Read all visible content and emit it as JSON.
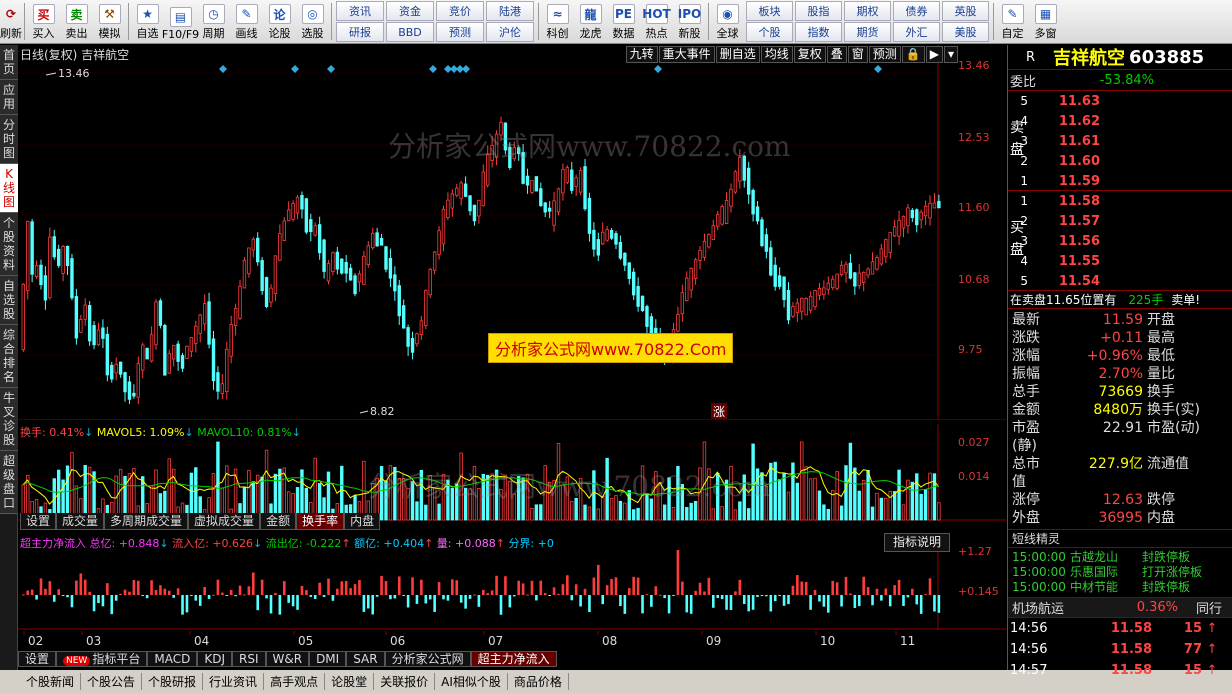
{
  "toolbar": {
    "group1": [
      {
        "label": "买入",
        "glyph": "买",
        "color": "#c00"
      },
      {
        "label": "卖出",
        "glyph": "卖",
        "color": "#080"
      },
      {
        "label": "模拟",
        "glyph": "⚒",
        "color": "#840"
      }
    ],
    "group2": [
      {
        "label": "自选",
        "glyph": "★"
      },
      {
        "label": "F10/F9",
        "glyph": "▤"
      },
      {
        "label": "周期",
        "glyph": "◷"
      },
      {
        "label": "画线",
        "glyph": "✎"
      },
      {
        "label": "论股",
        "glyph": "论"
      },
      {
        "label": "选股",
        "glyph": "◎"
      }
    ],
    "grid1": [
      "资讯",
      "资金",
      "竞价",
      "陆港",
      "研报",
      "BBD",
      "预测",
      "沪伦"
    ],
    "group3": [
      {
        "label": "科创",
        "glyph": "≈"
      },
      {
        "label": "龙虎",
        "glyph": "龍"
      },
      {
        "label": "数据",
        "glyph": "PE"
      },
      {
        "label": "热点",
        "glyph": "HOT"
      },
      {
        "label": "新股",
        "glyph": "IPO"
      }
    ],
    "group4": [
      {
        "label": "全球",
        "glyph": "◉"
      }
    ],
    "grid2": [
      "板块",
      "股指",
      "期权",
      "债券",
      "英股",
      "个股",
      "指数",
      "期货",
      "外汇",
      "美股"
    ],
    "group5": [
      {
        "label": "自定",
        "glyph": "✎"
      },
      {
        "label": "多窗",
        "glyph": "▦"
      }
    ],
    "left_label": "刷新"
  },
  "left_tabs": [
    "首页",
    "应用",
    "分时图",
    "K线图",
    "个股资料",
    "自选股",
    "综合排名",
    "牛叉诊股",
    "超级盘口"
  ],
  "chart": {
    "title": "日线(复权) 吉祥航空",
    "top_buttons": [
      "九转",
      "重大事件",
      "删自选",
      "均线",
      "复权",
      "叠",
      "窗",
      "预测"
    ],
    "price_labels": [
      "13.46",
      "12.53",
      "11.60",
      "10.68",
      "9.75"
    ],
    "high_label": "13.46",
    "low_label": "8.82",
    "zhang_label": "涨",
    "watermark": "分析家公式网www.70822.com",
    "watermark_center": "分析家公式网www.70822.Com",
    "watermark_2": "分析家公式网www.70822.com"
  },
  "volume": {
    "title_name": "换手:",
    "title_value": "0.41%",
    "ma5_name": "MAVOL5:",
    "ma5_value": "1.09%",
    "ma10_name": "MAVOL10:",
    "ma10_value": "0.81%",
    "y_labels": [
      "0.027",
      "0.014"
    ],
    "tabs": [
      "设置",
      "成交量",
      "多周期成交量",
      "虚拟成交量",
      "金额",
      "换手率",
      "内盘"
    ],
    "active_tab": "换手率"
  },
  "flow": {
    "title": "超主力净流入 总亿: +0.848",
    "in": "流入亿: +0.626",
    "out": "流出亿: -0.222",
    "amt": "额亿: +0.404",
    "qty": "量: +0.088",
    "bound": "分界: +0",
    "explain": "指标说明",
    "y_labels": [
      "+1.27",
      "+0.145"
    ]
  },
  "x_labels": [
    "02",
    "03",
    "04",
    "05",
    "06",
    "07",
    "08",
    "09",
    "10",
    "11"
  ],
  "bottom_tabs": [
    "设置",
    "指标平台",
    "MACD",
    "KDJ",
    "RSI",
    "W&R",
    "DMI",
    "SAR",
    "分析家公式网",
    "超主力净流入"
  ],
  "bottom_new_badge": "NEW",
  "bottom_active": "超主力净流入",
  "status_bar": [
    "个股新闻",
    "个股公告",
    "个股研报",
    "行业资讯",
    "高手观点",
    "论股堂",
    "关联报价",
    "AI相似个股",
    "商品价格"
  ],
  "quote": {
    "r": "R",
    "name": "吉祥航空",
    "code": "603885",
    "weibi_label": "委比",
    "weibi": "-53.84%",
    "sell_label": "卖盘",
    "buy_label": "买盘",
    "asks": [
      {
        "lvl": "5",
        "px": "11.63"
      },
      {
        "lvl": "4",
        "px": "11.62"
      },
      {
        "lvl": "3",
        "px": "11.61"
      },
      {
        "lvl": "2",
        "px": "11.60"
      },
      {
        "lvl": "1",
        "px": "11.59"
      }
    ],
    "bids": [
      {
        "lvl": "1",
        "px": "11.58"
      },
      {
        "lvl": "2",
        "px": "11.57"
      },
      {
        "lvl": "3",
        "px": "11.56"
      },
      {
        "lvl": "4",
        "px": "11.55"
      },
      {
        "lvl": "5",
        "px": "11.54"
      }
    ],
    "big_order": "在卖盘11.65位置有",
    "big_qty": "225手",
    "big_side": "卖单!",
    "stats": [
      {
        "k": "最新",
        "v": "11.59",
        "c": "rv",
        "k2": "开盘"
      },
      {
        "k": "涨跌",
        "v": "+0.11",
        "c": "rv",
        "k2": "最高"
      },
      {
        "k": "涨幅",
        "v": "+0.96%",
        "c": "rv",
        "k2": "最低"
      },
      {
        "k": "振幅",
        "v": "2.70%",
        "c": "rv",
        "k2": "量比"
      },
      {
        "k": "总手",
        "v": "73669",
        "c": "ry",
        "k2": "换手"
      },
      {
        "k": "金额",
        "v": "8480万",
        "c": "ry",
        "k2": "换手(实)"
      },
      {
        "k": "市盈(静)",
        "v": "22.91",
        "c": "",
        "k2": "市盈(动)"
      },
      {
        "k": "总市值",
        "v": "227.9亿",
        "c": "ry",
        "k2": "流通值"
      },
      {
        "k": "涨停",
        "v": "12.63",
        "c": "rv",
        "k2": "跌停"
      },
      {
        "k": "外盘",
        "v": "36995",
        "c": "rv",
        "k2": "内盘"
      }
    ],
    "news_title": "短线精灵",
    "news": [
      {
        "t": "15:00:00",
        "s": "古越龙山",
        "e": "封跌停板"
      },
      {
        "t": "15:00:00",
        "s": "乐惠国际",
        "e": "打开涨停板"
      },
      {
        "t": "15:00:00",
        "s": "中材节能",
        "e": "封跌停板"
      }
    ],
    "sector_name": "机场航运",
    "sector_chg": "0.36%",
    "sector_more": "同行",
    "ticks": [
      {
        "t": "14:56",
        "p": "11.58",
        "q": "15",
        "d": "↑"
      },
      {
        "t": "14:56",
        "p": "11.58",
        "q": "77",
        "d": "↑"
      },
      {
        "t": "14:57",
        "p": "11.58",
        "q": "15",
        "d": "↑"
      }
    ]
  },
  "colors": {
    "up": "#ff3c3c",
    "down": "#54ffff",
    "ma5": "#ffff00",
    "ma10": "#00cc00",
    "grid": "#800000"
  }
}
